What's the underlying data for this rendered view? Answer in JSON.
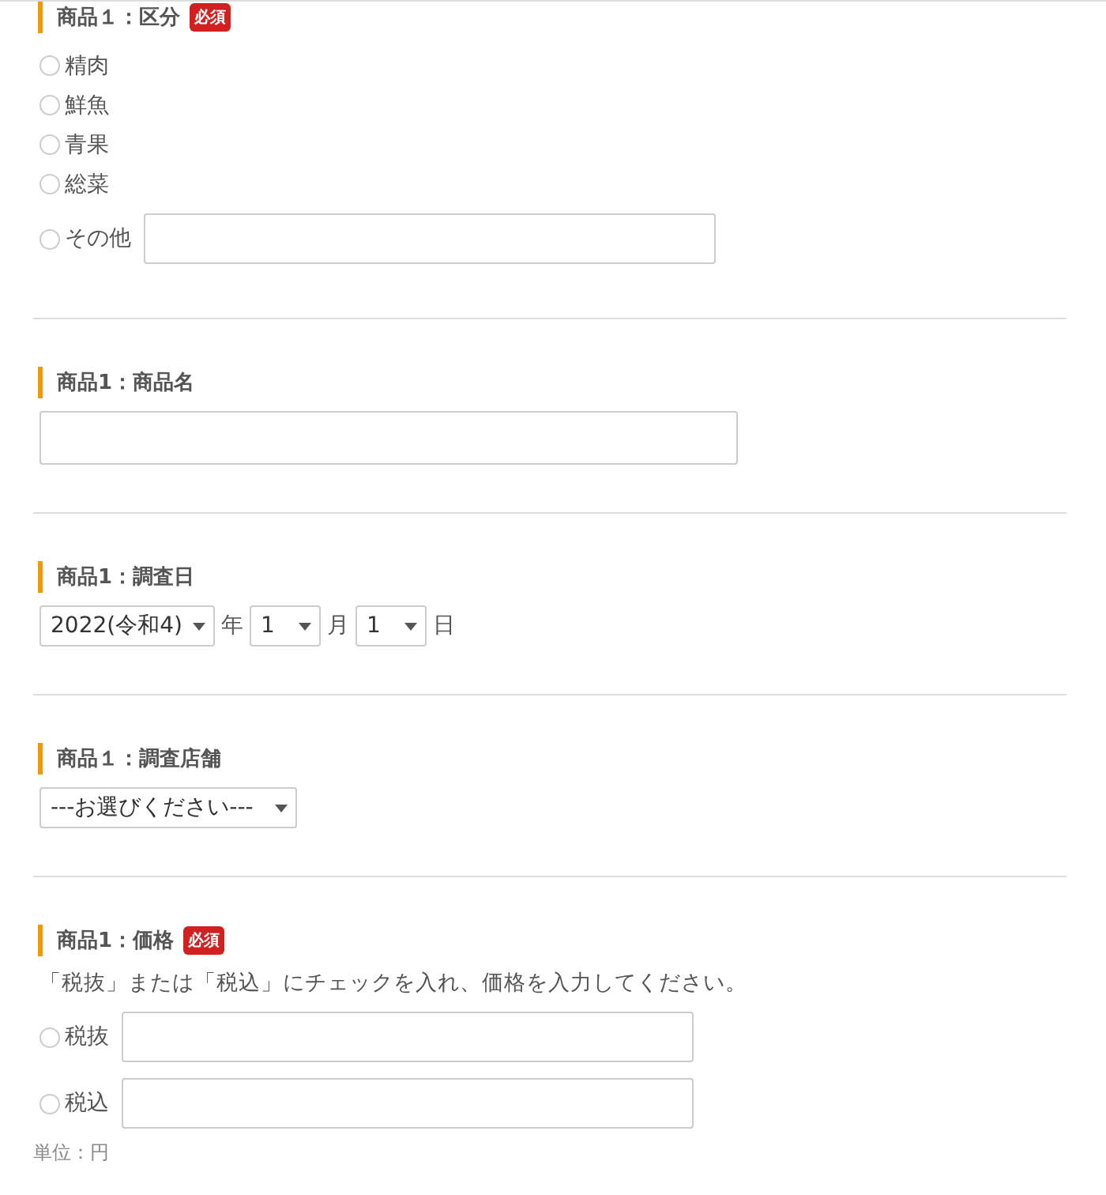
{
  "sections": [
    {
      "kind": "radio_group",
      "label": "商品１：区分",
      "required_badge": "必須",
      "options": [
        {
          "label": "精肉",
          "selected": false
        },
        {
          "label": "鮮魚",
          "selected": false
        },
        {
          "label": "青果",
          "selected": false
        },
        {
          "label": "総菜",
          "selected": false
        },
        {
          "label": "その他",
          "selected": false,
          "has_input": true
        }
      ]
    },
    {
      "kind": "text",
      "label": "商品1：商品名"
    },
    {
      "kind": "date",
      "label": "商品1：調査日",
      "year": "2022(令和4)",
      "year_unit": "年",
      "month": "1",
      "month_unit": "月",
      "day": "1",
      "day_unit": "日"
    },
    {
      "kind": "select",
      "label": "商品１：調査店舗",
      "value": "---お選びください---"
    },
    {
      "kind": "price",
      "label": "商品1：価格",
      "required_badge": "必須",
      "instruction": "「税抜」または「税込」にチェックを入れ、価格を入力してください。",
      "options": [
        {
          "label": "税抜",
          "selected": false
        },
        {
          "label": "税込",
          "selected": false
        }
      ],
      "unit_note": "単位：円"
    }
  ]
}
